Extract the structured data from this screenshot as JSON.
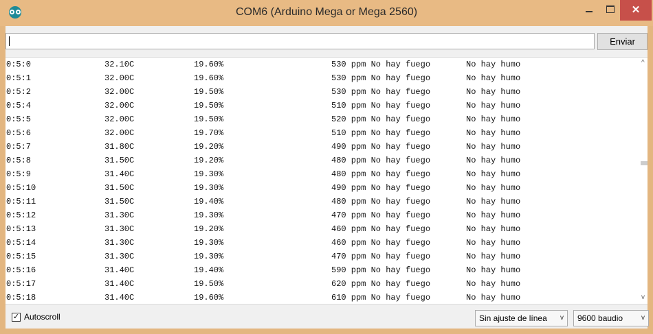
{
  "window": {
    "title": "COM6 (Arduino Mega or Mega 2560)",
    "colors": {
      "titlebar": "#e8ba84",
      "close_button": "#c7504a"
    },
    "icons": {
      "app": "arduino-icon",
      "minimize": "minimize-icon",
      "maximize": "maximize-icon",
      "close": "close-icon"
    },
    "close_glyph": "✕"
  },
  "send": {
    "input_value": "",
    "button_label": "Enviar"
  },
  "output": {
    "rows": [
      [
        "0:5:0",
        "32.10C",
        "19.60%",
        "530 ppm No hay fuego",
        "No hay humo"
      ],
      [
        "0:5:1",
        "32.00C",
        "19.60%",
        "530 ppm No hay fuego",
        "No hay humo"
      ],
      [
        "0:5:2",
        "32.00C",
        "19.50%",
        "530 ppm No hay fuego",
        "No hay humo"
      ],
      [
        "0:5:4",
        "32.00C",
        "19.50%",
        "510 ppm No hay fuego",
        "No hay humo"
      ],
      [
        "0:5:5",
        "32.00C",
        "19.50%",
        "520 ppm No hay fuego",
        "No hay humo"
      ],
      [
        "0:5:6",
        "32.00C",
        "19.70%",
        "510 ppm No hay fuego",
        "No hay humo"
      ],
      [
        "0:5:7",
        "31.80C",
        "19.20%",
        "490 ppm No hay fuego",
        "No hay humo"
      ],
      [
        "0:5:8",
        "31.50C",
        "19.20%",
        "480 ppm No hay fuego",
        "No hay humo"
      ],
      [
        "0:5:9",
        "31.40C",
        "19.30%",
        "480 ppm No hay fuego",
        "No hay humo"
      ],
      [
        "0:5:10",
        "31.50C",
        "19.30%",
        "490 ppm No hay fuego",
        "No hay humo"
      ],
      [
        "0:5:11",
        "31.50C",
        "19.40%",
        "480 ppm No hay fuego",
        "No hay humo"
      ],
      [
        "0:5:12",
        "31.30C",
        "19.30%",
        "470 ppm No hay fuego",
        "No hay humo"
      ],
      [
        "0:5:13",
        "31.30C",
        "19.20%",
        "460 ppm No hay fuego",
        "No hay humo"
      ],
      [
        "0:5:14",
        "31.30C",
        "19.30%",
        "460 ppm No hay fuego",
        "No hay humo"
      ],
      [
        "0:5:15",
        "31.30C",
        "19.30%",
        "470 ppm No hay fuego",
        "No hay humo"
      ],
      [
        "0:5:16",
        "31.40C",
        "19.40%",
        "590 ppm No hay fuego",
        "No hay humo"
      ],
      [
        "0:5:17",
        "31.40C",
        "19.50%",
        "620 ppm No hay fuego",
        "No hay humo"
      ],
      [
        "0:5:18",
        "31.40C",
        "19.60%",
        "610 ppm No hay fuego",
        "No hay humo"
      ]
    ],
    "scroll_up_glyph": "^",
    "scroll_down_glyph": "v"
  },
  "footer": {
    "autoscroll": {
      "label": "Autoscroll",
      "checked": true,
      "check_glyph": "✓"
    },
    "line_ending": {
      "selected": "Sin ajuste de línea"
    },
    "baud_rate": {
      "selected": "9600 baudio"
    },
    "dropdown_glyph": "v"
  }
}
